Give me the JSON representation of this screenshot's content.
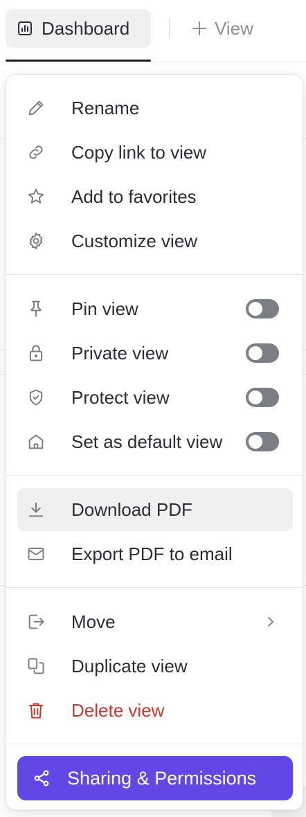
{
  "tabs": {
    "active_label": "Dashboard",
    "add_label": "View"
  },
  "menu": {
    "group1": [
      {
        "label": "Rename",
        "icon": "pencil-icon"
      },
      {
        "label": "Copy link to view",
        "icon": "link-icon"
      },
      {
        "label": "Add to favorites",
        "icon": "star-icon"
      },
      {
        "label": "Customize view",
        "icon": "gear-icon"
      }
    ],
    "group2": [
      {
        "label": "Pin view",
        "icon": "pin-icon",
        "toggle_on": false
      },
      {
        "label": "Private view",
        "icon": "lock-icon",
        "toggle_on": false
      },
      {
        "label": "Protect view",
        "icon": "shield-icon",
        "toggle_on": false
      },
      {
        "label": "Set as default view",
        "icon": "home-icon",
        "toggle_on": false
      }
    ],
    "group3": [
      {
        "label": "Download PDF",
        "icon": "download-icon",
        "highlighted": true
      },
      {
        "label": "Export PDF to email",
        "icon": "mail-icon"
      }
    ],
    "group4": [
      {
        "label": "Move",
        "icon": "move-icon",
        "has_submenu": true
      },
      {
        "label": "Duplicate view",
        "icon": "duplicate-icon"
      },
      {
        "label": "Delete view",
        "icon": "trash-icon",
        "danger": true
      }
    ],
    "share_button": {
      "label": "Sharing & Permissions",
      "icon": "share-icon"
    }
  },
  "colors": {
    "accent": "#6346e6",
    "danger": "#c23b30",
    "toggle_off": "#7b7e84",
    "hover_bg": "#f0f0f0"
  }
}
